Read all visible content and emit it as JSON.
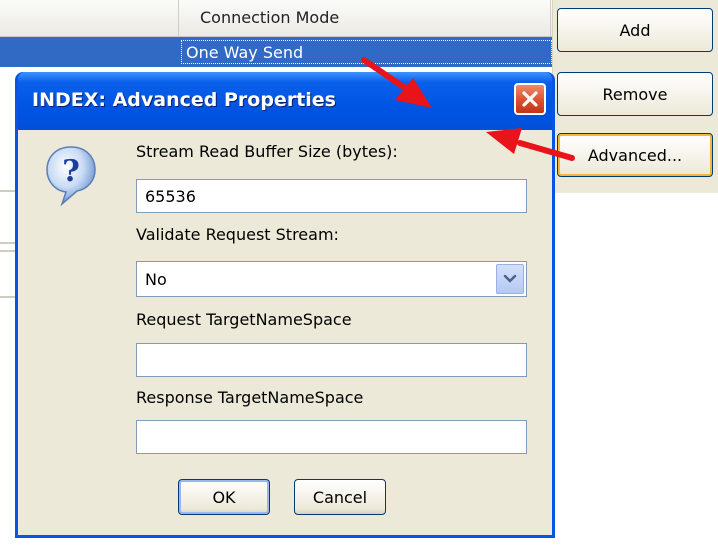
{
  "background": {
    "grid_header": "Connection Mode",
    "selected_row": "One Way Send",
    "buttons": {
      "add": "Add",
      "remove": "Remove",
      "advanced": "Advanced..."
    }
  },
  "dialog": {
    "title": "INDEX: Advanced Properties",
    "fields": {
      "stream_buffer_label": "Stream Read Buffer Size (bytes):",
      "stream_buffer_value": "65536",
      "validate_label": "Validate Request Stream:",
      "validate_value": "No",
      "request_ns_label": "Request TargetNameSpace",
      "request_ns_value": "",
      "response_ns_label": "Response TargetNameSpace",
      "response_ns_value": ""
    },
    "buttons": {
      "ok": "OK",
      "cancel": "Cancel"
    }
  },
  "colors": {
    "titlebar": "#0054e3",
    "dialog_face": "#ece9d8",
    "selection": "#316ac5",
    "annotation_arrow": "#e8141a",
    "close_button": "#d94b2b"
  },
  "icons": {
    "question": "question-icon",
    "close": "close-icon",
    "dropdown": "chevron-down-icon"
  }
}
